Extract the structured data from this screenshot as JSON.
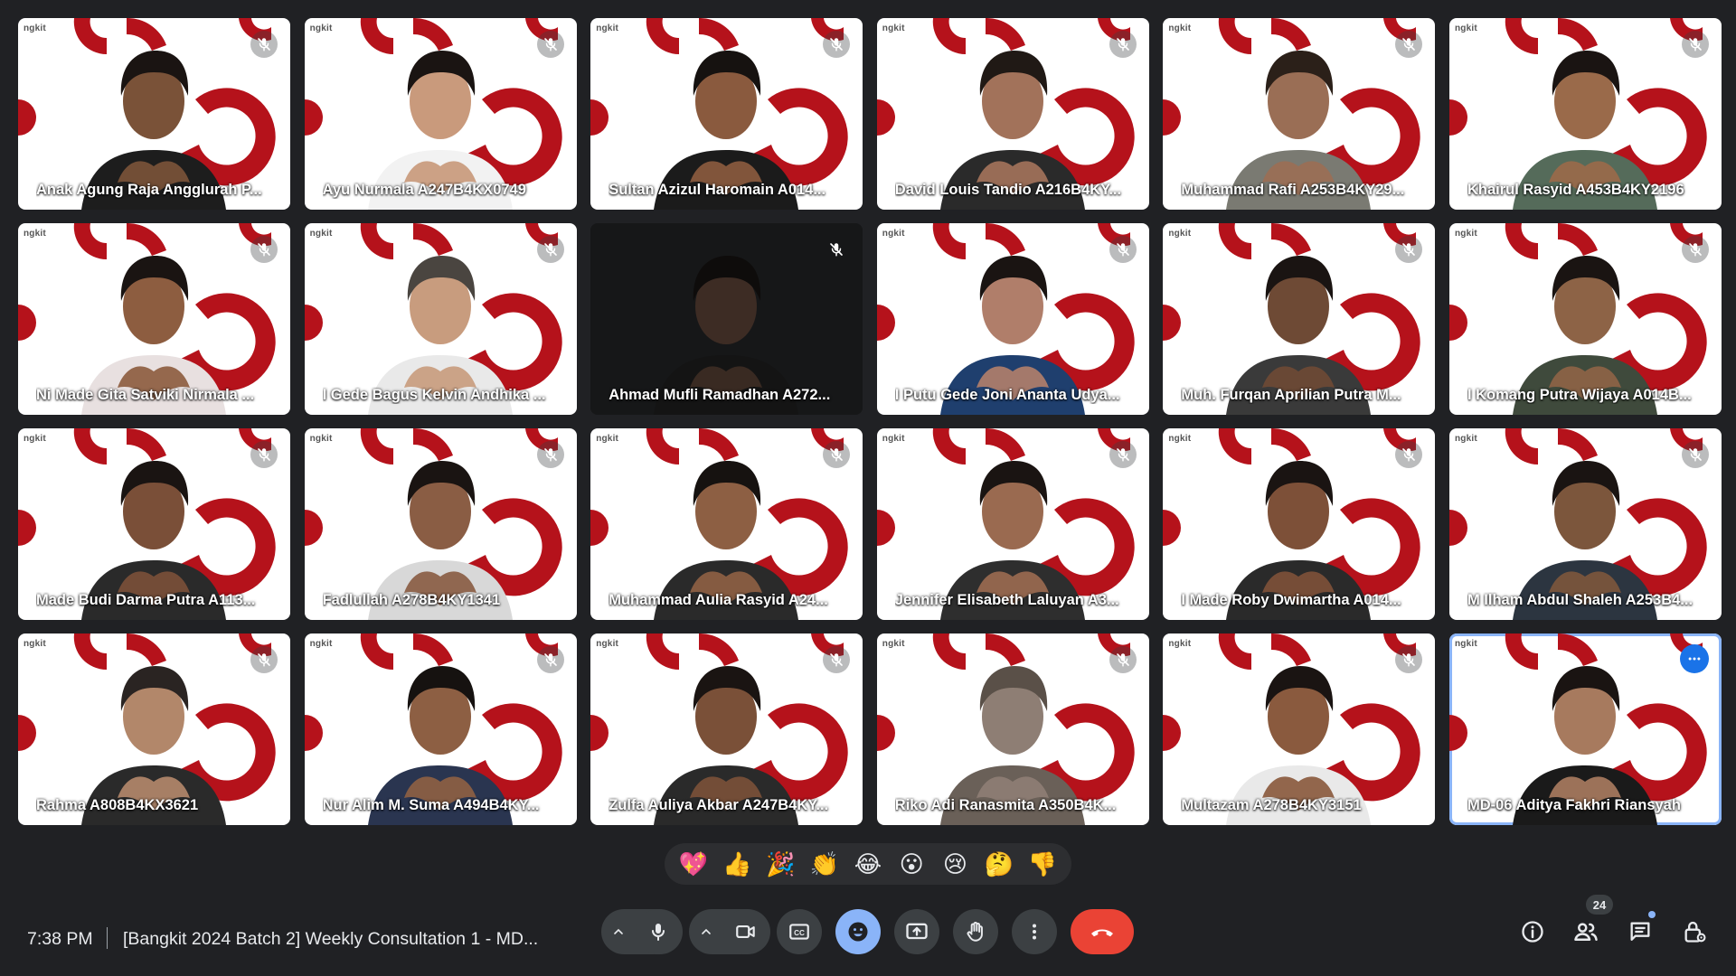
{
  "participants": [
    {
      "name": "Anak Agung Raja Angglurah P...",
      "muted": true,
      "skin": "#7a5238",
      "hair": "#1a1412",
      "shirt": "#1d1d1d"
    },
    {
      "name": "Ayu Nurmala A247B4KX0749",
      "muted": true,
      "skin": "#c99a7c",
      "hair": "#1a1412",
      "shirt": "#f2f2f2"
    },
    {
      "name": "Sultan Azizul Haromain A014...",
      "muted": true,
      "skin": "#8a5a3e",
      "hair": "#161210",
      "shirt": "#1b1b1b"
    },
    {
      "name": "David Louis Tandio A216B4KY...",
      "muted": true,
      "skin": "#a2725a",
      "hair": "#201915",
      "shirt": "#2a2a2a"
    },
    {
      "name": "Muhammad Rafi A253B4KY29...",
      "muted": true,
      "skin": "#9a6e55",
      "hair": "#2b2019",
      "shirt": "#7a7a72"
    },
    {
      "name": "Khairul Rasyid A453B4KY2196",
      "muted": true,
      "skin": "#9a6a4a",
      "hair": "#1a1412",
      "shirt": "#556b5a"
    },
    {
      "name": "Ni Made Gita Satviki Nirmala ...",
      "muted": true,
      "skin": "#8d5d40",
      "hair": "#1a1412",
      "shirt": "#e8e0e0"
    },
    {
      "name": "I Gede Bagus Kelvin Andhika ...",
      "muted": true,
      "skin": "#c89c7e",
      "hair": "#4a4540",
      "shirt": "#e9e9e9"
    },
    {
      "name": "Ahmad Mufli Ramadhan A272...",
      "muted": true,
      "skin": "#3d2c24",
      "hair": "#0e0c0b",
      "shirt": "#141414"
    },
    {
      "name": "I Putu Gede Joni Ananta Udya...",
      "muted": true,
      "skin": "#b07e6a",
      "hair": "#1a1412",
      "shirt": "#1f3f6e"
    },
    {
      "name": "Muh. Furqan Aprilian Putra M...",
      "muted": true,
      "skin": "#6e4a35",
      "hair": "#1a1412",
      "shirt": "#3a3a3a"
    },
    {
      "name": "I Komang Putra Wijaya A014B...",
      "muted": true,
      "skin": "#8d6346",
      "hair": "#1a1412",
      "shirt": "#3f4a3c"
    },
    {
      "name": "Made Budi Darma Putra A113...",
      "muted": true,
      "skin": "#7a4f38",
      "hair": "#1a1412",
      "shirt": "#2a2a2a"
    },
    {
      "name": "Fadlullah A278B4KY1341",
      "muted": true,
      "skin": "#8a5d44",
      "hair": "#1a1412",
      "shirt": "#d8d8d8"
    },
    {
      "name": "Muhammad Aulia Rasyid A24...",
      "muted": true,
      "skin": "#8d5f43",
      "hair": "#161210",
      "shirt": "#2a2a2a"
    },
    {
      "name": "Jennifer Elisabeth Laluyan A3...",
      "muted": true,
      "skin": "#9a6a50",
      "hair": "#1a1412",
      "shirt": "#2e2e2e"
    },
    {
      "name": "I Made Roby Dwimartha A014...",
      "muted": true,
      "skin": "#7d5038",
      "hair": "#1a1412",
      "shirt": "#2a2a2a"
    },
    {
      "name": "M Ilham Abdul Shaleh A253B4...",
      "muted": true,
      "skin": "#7c563c",
      "hair": "#1a1412",
      "shirt": "#2c3540"
    },
    {
      "name": "Rahma A808B4KX3621",
      "muted": true,
      "skin": "#b2876a",
      "hair": "#2a2422",
      "shirt": "#2a2a2a"
    },
    {
      "name": "Nur Alim M. Suma A494B4KY...",
      "muted": true,
      "skin": "#8d5f43",
      "hair": "#161210",
      "shirt": "#2a3550"
    },
    {
      "name": "Zulfa Auliya Akbar A247B4KY...",
      "muted": true,
      "skin": "#7a5038",
      "hair": "#1a1412",
      "shirt": "#2a2a2a"
    },
    {
      "name": "Riko Adi Ranasmita A350B4K...",
      "muted": true,
      "skin": "#8e7e74",
      "hair": "#5a5048",
      "shirt": "#6a6058"
    },
    {
      "name": "Multazam A278B4KY3151",
      "muted": true,
      "skin": "#8a5a3e",
      "hair": "#1a1412",
      "shirt": "#e9e9e9"
    },
    {
      "name": "MD-06 Aditya Fakhri Riansyah",
      "muted": false,
      "active": true,
      "skin": "#a77a5e",
      "hair": "#1a1412",
      "shirt": "#1a1a1a"
    }
  ],
  "tile_brand_text": "ngkit",
  "reactions": [
    {
      "emoji": "💖",
      "name": "sparkling-heart"
    },
    {
      "emoji": "👍",
      "name": "thumbs-up"
    },
    {
      "emoji": "🎉",
      "name": "party-popper"
    },
    {
      "emoji": "👏",
      "name": "clapping-hands"
    },
    {
      "emoji": "😂",
      "name": "tears-of-joy"
    },
    {
      "emoji": "😮",
      "name": "surprised-face"
    },
    {
      "emoji": "😢",
      "name": "crying-face"
    },
    {
      "emoji": "🤔",
      "name": "thinking-face"
    },
    {
      "emoji": "👎",
      "name": "thumbs-down"
    }
  ],
  "footer": {
    "time": "7:38 PM",
    "separator": "|",
    "meeting_title": "[Bangkit 2024 Batch 2] Weekly Consultation 1 - MD...",
    "people_count": "24"
  },
  "colors": {
    "background": "#202124",
    "control": "#3c4043",
    "accent": "#8ab4f8",
    "end_call": "#ea4335",
    "brand_red": "#b5121b"
  },
  "icons": {
    "mic_muted": "mic-off-icon",
    "mic": "mic-icon",
    "camera": "videocam-icon",
    "captions": "closed-caption-icon",
    "emoji": "emoji-icon",
    "present": "present-screen-icon",
    "hand": "raise-hand-icon",
    "more": "more-vert-icon",
    "end": "call-end-icon",
    "info": "info-icon",
    "people": "people-icon",
    "chat": "chat-icon",
    "host": "host-controls-icon"
  }
}
